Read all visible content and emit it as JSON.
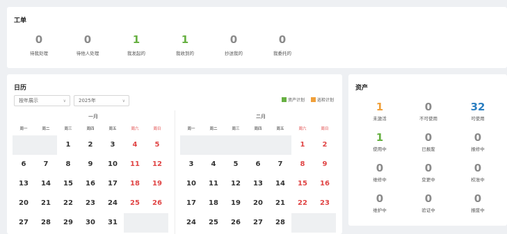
{
  "work_orders": {
    "title": "工单",
    "items": [
      {
        "value": "0",
        "label": "待我处理",
        "color": "#8a8a8a"
      },
      {
        "value": "0",
        "label": "待他人处理",
        "color": "#8a8a8a"
      },
      {
        "value": "1",
        "label": "我发起的",
        "color": "#67b042"
      },
      {
        "value": "1",
        "label": "我收到的",
        "color": "#67b042"
      },
      {
        "value": "0",
        "label": "抄送我的",
        "color": "#8a8a8a"
      },
      {
        "value": "0",
        "label": "我委托的",
        "color": "#8a8a8a"
      }
    ]
  },
  "calendar": {
    "title": "日历",
    "view_select": "按年展示",
    "year_select": "2025年",
    "legend": [
      {
        "label": "资产计划",
        "color": "#67b042"
      },
      {
        "label": "巡检计划",
        "color": "#f0a03a"
      }
    ],
    "weekdays": [
      "周一",
      "周二",
      "周三",
      "周四",
      "周五",
      "周六",
      "周日"
    ],
    "months": [
      {
        "title": "一月",
        "weeks": [
          [
            "",
            "",
            "1",
            "2",
            "3",
            "4",
            "5"
          ],
          [
            "6",
            "7",
            "8",
            "9",
            "10",
            "11",
            "12"
          ],
          [
            "13",
            "14",
            "15",
            "16",
            "17",
            "18",
            "19"
          ],
          [
            "20",
            "21",
            "22",
            "23",
            "24",
            "25",
            "26"
          ],
          [
            "27",
            "28",
            "29",
            "30",
            "31",
            "",
            ""
          ]
        ]
      },
      {
        "title": "二月",
        "weeks": [
          [
            "",
            "",
            "",
            "",
            "",
            "1",
            "2"
          ],
          [
            "3",
            "4",
            "5",
            "6",
            "7",
            "8",
            "9"
          ],
          [
            "10",
            "11",
            "12",
            "13",
            "14",
            "15",
            "16"
          ],
          [
            "17",
            "18",
            "19",
            "20",
            "21",
            "22",
            "23"
          ],
          [
            "24",
            "25",
            "26",
            "27",
            "28",
            "",
            ""
          ]
        ]
      }
    ]
  },
  "assets": {
    "title": "资产",
    "items": [
      {
        "value": "1",
        "label": "未激活",
        "color": "#f0a03a"
      },
      {
        "value": "0",
        "label": "不可使用",
        "color": "#8a8a8a"
      },
      {
        "value": "32",
        "label": "可使用",
        "color": "#2b7fc1"
      },
      {
        "value": "1",
        "label": "使用中",
        "color": "#67b042"
      },
      {
        "value": "0",
        "label": "已报废",
        "color": "#8a8a8a"
      },
      {
        "value": "0",
        "label": "报修中",
        "color": "#8a8a8a"
      },
      {
        "value": "0",
        "label": "维修中",
        "color": "#8a8a8a"
      },
      {
        "value": "0",
        "label": "变更中",
        "color": "#8a8a8a"
      },
      {
        "value": "0",
        "label": "校准中",
        "color": "#8a8a8a"
      },
      {
        "value": "0",
        "label": "维护中",
        "color": "#8a8a8a"
      },
      {
        "value": "0",
        "label": "验证中",
        "color": "#8a8a8a"
      },
      {
        "value": "0",
        "label": "报废中",
        "color": "#8a8a8a"
      }
    ]
  }
}
